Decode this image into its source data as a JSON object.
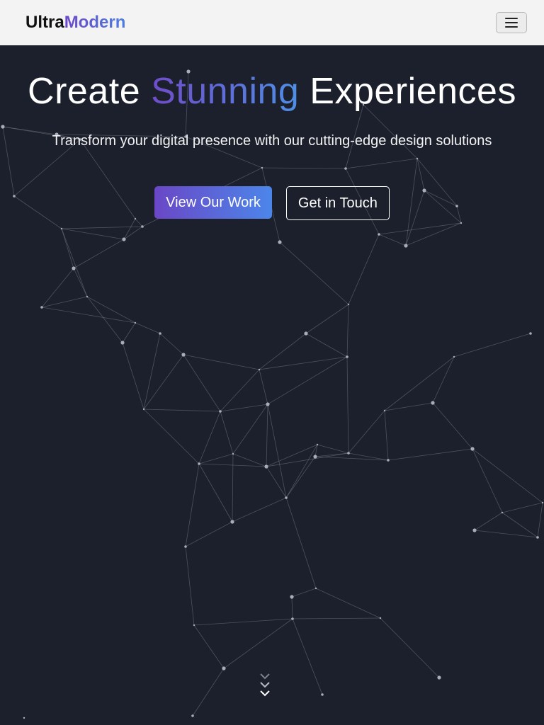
{
  "brand": {
    "part1": "Ultra",
    "part2": "Modern"
  },
  "nav": {
    "menu_icon": "hamburger-menu-icon"
  },
  "hero": {
    "title_before": "Create ",
    "title_highlight": "Stunning",
    "title_after": " Experiences",
    "subtitle": "Transform your digital presence with our cutting-edge design solutions",
    "primary_button": "View Our Work",
    "secondary_button": "Get in Touch"
  },
  "scroll_icon": "chevrons-down-icon",
  "colors": {
    "background": "#1b202c",
    "navbar": "#f3f3f3",
    "accent_start": "#6b48c7",
    "accent_end": "#4f86ea"
  }
}
